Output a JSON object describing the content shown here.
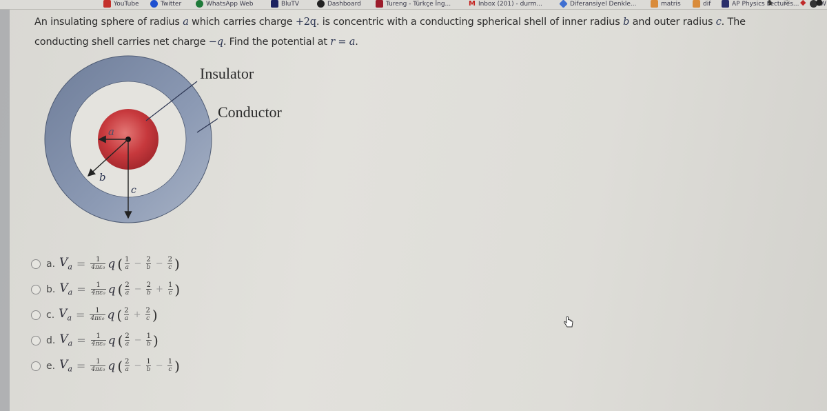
{
  "browser": {
    "bookmarks": [
      {
        "label": "YouTube",
        "icon": "youtube-icon",
        "color": "#c4302b"
      },
      {
        "label": "Twitter",
        "icon": "twitter-icon",
        "color": "#1d4fd0"
      },
      {
        "label": "WhatsApp Web",
        "icon": "whatsapp-icon",
        "color": "#1f7a3a"
      },
      {
        "label": "BluTV",
        "icon": "blutv-icon",
        "color": "#1b2160"
      },
      {
        "label": "Dashboard",
        "icon": "dashboard-icon",
        "color": "#222222"
      },
      {
        "label": "Tureng - Türkçe İng...",
        "icon": "tureng-icon",
        "color": "#9c1c2b"
      },
      {
        "label": "Inbox (201) - durm...",
        "icon": "gmail-icon",
        "color": "#c5221f"
      },
      {
        "label": "Diferansiyel Denkle...",
        "icon": "diamond-icon",
        "color": "#3f6fd1"
      },
      {
        "label": "matris",
        "icon": "folder-icon",
        "color": "#d98b3a"
      },
      {
        "label": "dif",
        "icon": "folder-icon",
        "color": "#d98b3a"
      },
      {
        "label": "AP Physics Lectures...",
        "icon": "ap-icon",
        "color": "#2b2f6b"
      },
      {
        "label": "W",
        "icon": "globe-icon",
        "color": "#333333"
      }
    ]
  },
  "question": {
    "part1": "An insulating sphere of radius ",
    "var_a": "a",
    "part2": " which carries charge ",
    "charge": "+2q",
    "part3": ". is concentric with a conducting spherical shell of inner radius ",
    "var_b": "b",
    "part4": " and outer radius ",
    "var_c": "c",
    "part5": ". The conducting shell carries net charge ",
    "net_charge": "−q",
    "part6": ". Find the potential at ",
    "at_r": "r = a",
    "part7": "."
  },
  "figure": {
    "insulator_label": "Insulator",
    "conductor_label": "Conductor",
    "radius_a": "a",
    "radius_b": "b",
    "radius_c": "c",
    "colors": {
      "sphere": "#c7393d",
      "shell": "#7e8ca8",
      "gap": "#e4e3de"
    }
  },
  "options": [
    {
      "letter": "a.",
      "lhs": "V",
      "sub": "a",
      "coef_num": "1",
      "coef_den": "4πε₀",
      "var": "q",
      "terms": [
        {
          "op": "",
          "num": "1",
          "den": "a"
        },
        {
          "op": "−",
          "num": "2",
          "den": "b"
        },
        {
          "op": "−",
          "num": "2",
          "den": "c"
        }
      ]
    },
    {
      "letter": "b.",
      "lhs": "V",
      "sub": "a",
      "coef_num": "1",
      "coef_den": "4πε₀",
      "var": "q",
      "terms": [
        {
          "op": "",
          "num": "2",
          "den": "a"
        },
        {
          "op": "−",
          "num": "2",
          "den": "b"
        },
        {
          "op": "+",
          "num": "1",
          "den": "c"
        }
      ]
    },
    {
      "letter": "c.",
      "lhs": "V",
      "sub": "a",
      "coef_num": "1",
      "coef_den": "4πε₀",
      "var": "q",
      "terms": [
        {
          "op": "",
          "num": "2",
          "den": "a"
        },
        {
          "op": "+",
          "num": "2",
          "den": "c"
        }
      ]
    },
    {
      "letter": "d.",
      "lhs": "V",
      "sub": "a",
      "coef_num": "1",
      "coef_den": "4πε₀",
      "var": "q",
      "terms": [
        {
          "op": "",
          "num": "2",
          "den": "a"
        },
        {
          "op": "−",
          "num": "1",
          "den": "b"
        }
      ]
    },
    {
      "letter": "e.",
      "lhs": "V",
      "sub": "a",
      "coef_num": "1",
      "coef_den": "4πε₀",
      "var": "q",
      "terms": [
        {
          "op": "",
          "num": "2",
          "den": "a"
        },
        {
          "op": "−",
          "num": "1",
          "den": "b"
        },
        {
          "op": "−",
          "num": "1",
          "den": "c"
        }
      ]
    }
  ],
  "symbols": {
    "equals": "=",
    "lparen": "(",
    "rparen": ")"
  }
}
